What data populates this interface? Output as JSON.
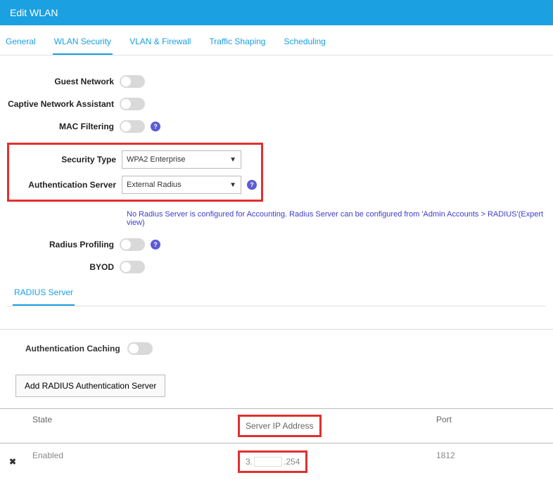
{
  "header": {
    "title": "Edit WLAN"
  },
  "tabs": {
    "items": [
      {
        "label": "General"
      },
      {
        "label": "WLAN Security"
      },
      {
        "label": "VLAN & Firewall"
      },
      {
        "label": "Traffic Shaping"
      },
      {
        "label": "Scheduling"
      }
    ]
  },
  "form": {
    "guest_network": {
      "label": "Guest Network"
    },
    "captive_assistant": {
      "label": "Captive Network Assistant"
    },
    "mac_filtering": {
      "label": "MAC Filtering"
    },
    "security_type": {
      "label": "Security Type",
      "value": "WPA2 Enterprise"
    },
    "auth_server": {
      "label": "Authentication Server",
      "value": "External Radius"
    },
    "notice": "No Radius Server is configured for Accounting. Radius Server can be configured from 'Admin Accounts > RADIUS'(Expert view)",
    "radius_profiling": {
      "label": "Radius Profiling"
    },
    "byod": {
      "label": "BYOD"
    }
  },
  "subtabs": {
    "radius_server": "RADIUS Server"
  },
  "auth_caching": {
    "label": "Authentication Caching"
  },
  "add_button": {
    "label": "Add RADIUS Authentication Server"
  },
  "table": {
    "headers": {
      "state": "State",
      "server_ip": "Server IP Address",
      "port": "Port"
    },
    "rows": [
      {
        "state": "Enabled",
        "ip_prefix": "3.",
        "ip_suffix": ".254",
        "port": "1812"
      }
    ]
  }
}
